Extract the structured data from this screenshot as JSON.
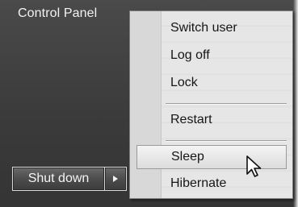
{
  "start_menu": {
    "control_panel_label": "Control Panel",
    "shutdown_button_label": "Shut down"
  },
  "shutdown_options_menu": {
    "items": [
      {
        "label": "Switch user"
      },
      {
        "label": "Log off"
      },
      {
        "label": "Lock"
      },
      {
        "label": "Restart"
      },
      {
        "label": "Sleep",
        "highlighted": true
      },
      {
        "label": "Hibernate"
      }
    ]
  },
  "icons": {
    "arrow_button_icon": "triangle-right-icon",
    "pointer_icon": "mouse-cursor-icon"
  }
}
